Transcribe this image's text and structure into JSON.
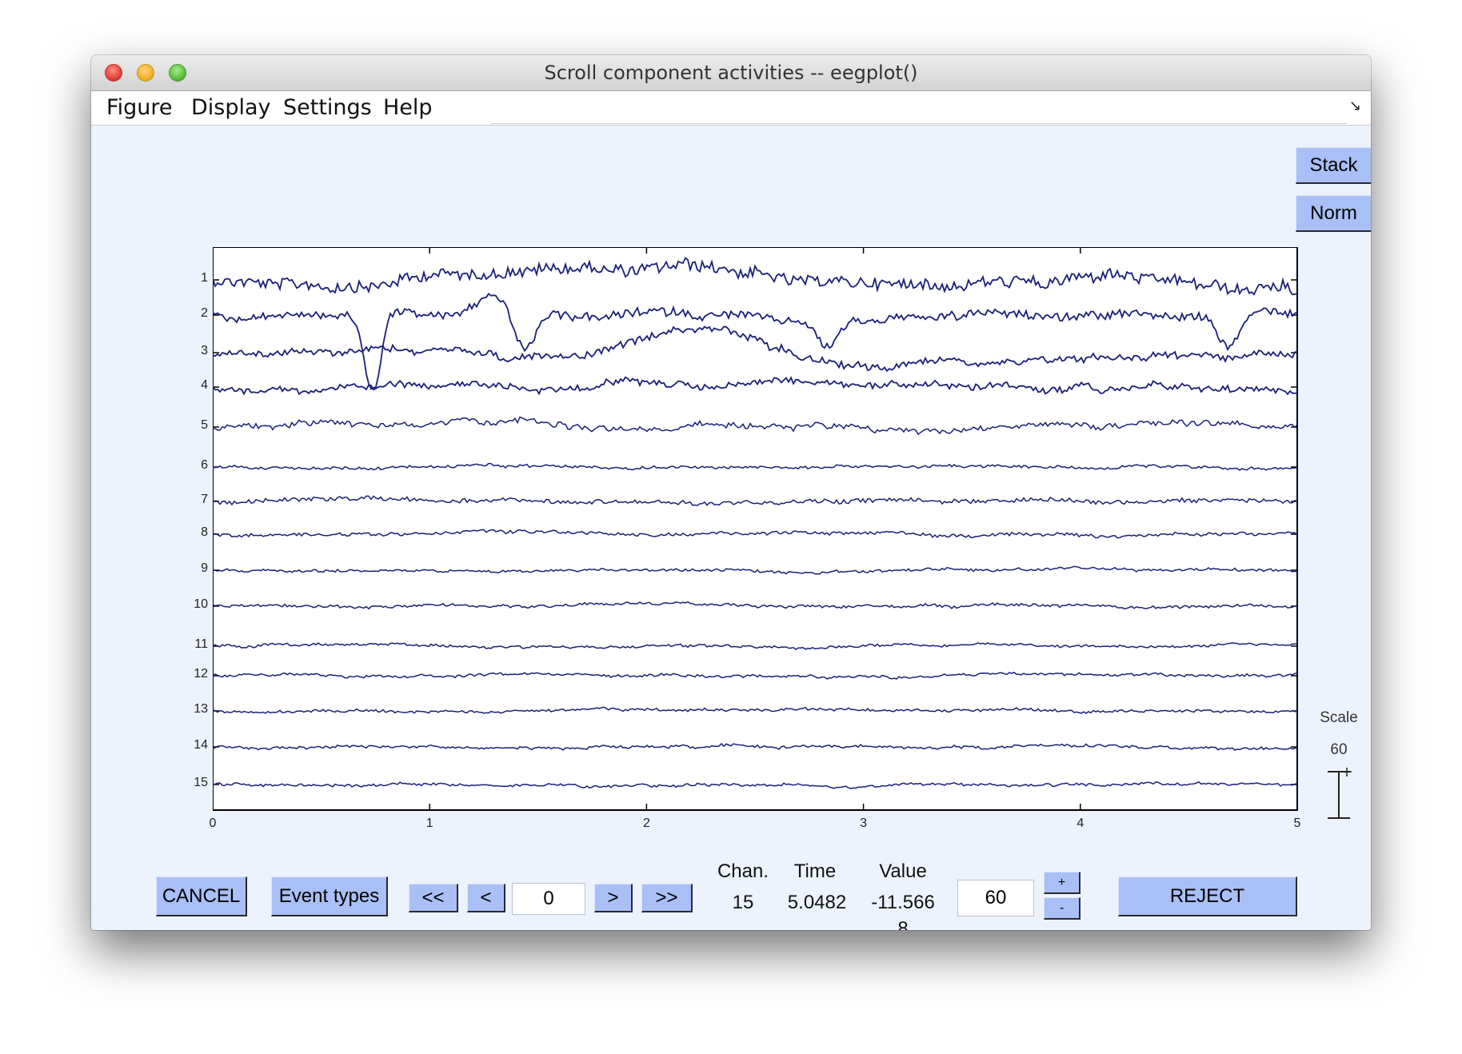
{
  "window": {
    "title": "Scroll component activities -- eegplot()"
  },
  "menu": [
    "Figure",
    "Display",
    "Settings",
    "Help"
  ],
  "side_buttons": {
    "stack": "Stack",
    "norm": "Norm"
  },
  "scale": {
    "label": "Scale",
    "value": "60"
  },
  "chart_data": {
    "type": "line",
    "channels": [
      "1",
      "2",
      "3",
      "4",
      "5",
      "6",
      "7",
      "8",
      "9",
      "10",
      "11",
      "12",
      "13",
      "14",
      "15"
    ],
    "x_ticks": [
      "0",
      "1",
      "2",
      "3",
      "4",
      "5"
    ],
    "xlim": [
      0,
      5
    ],
    "xlabel": "",
    "ylabel": ""
  },
  "controls": {
    "cancel": "CANCEL",
    "event_types": "Event types",
    "first": "<<",
    "prev": "<",
    "position": "0",
    "next": ">",
    "last": ">>",
    "window_length": "60",
    "plus": "+",
    "minus": "-",
    "reject": "REJECT"
  },
  "readout": {
    "chan_label": "Chan.",
    "time_label": "Time",
    "value_label": "Value",
    "chan": "15",
    "time": "5.0482",
    "value": "-11.566",
    "value_overflow": "8"
  }
}
